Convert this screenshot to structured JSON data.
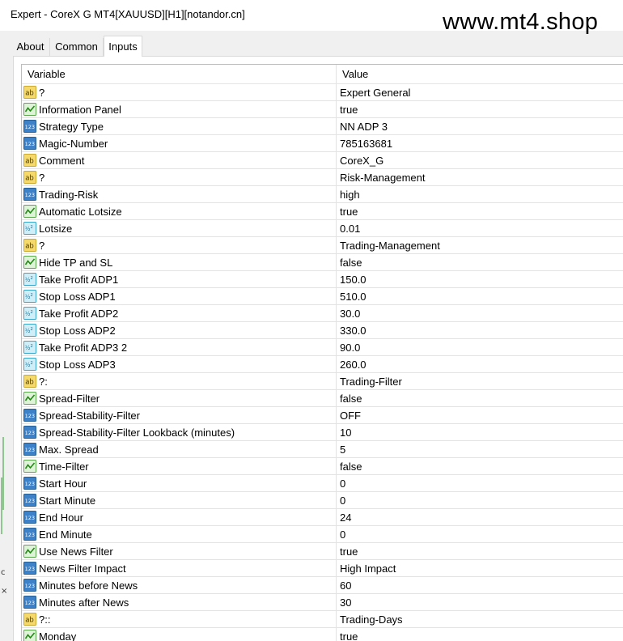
{
  "window": {
    "title": "Expert - CoreX G MT4[XAUUSD][H1][notandor.cn]"
  },
  "watermark": "www.mt4.shop",
  "tabs": [
    {
      "label": "About",
      "active": false
    },
    {
      "label": "Common",
      "active": false
    },
    {
      "label": "Inputs",
      "active": true
    }
  ],
  "table": {
    "columns": {
      "variable": "Variable",
      "value": "Value"
    },
    "rows": [
      {
        "icon": "ab",
        "variable": "?",
        "value": "Expert General"
      },
      {
        "icon": "bool",
        "variable": "Information Panel",
        "value": "true"
      },
      {
        "icon": "int",
        "variable": "Strategy Type",
        "value": "NN ADP 3"
      },
      {
        "icon": "int",
        "variable": "Magic-Number",
        "value": "785163681"
      },
      {
        "icon": "ab",
        "variable": "Comment",
        "value": "CoreX_G"
      },
      {
        "icon": "ab",
        "variable": "?",
        "value": "Risk-Management"
      },
      {
        "icon": "int",
        "variable": "Trading-Risk",
        "value": "high"
      },
      {
        "icon": "bool",
        "variable": "Automatic Lotsize",
        "value": "true"
      },
      {
        "icon": "dbl",
        "variable": "Lotsize",
        "value": "0.01"
      },
      {
        "icon": "ab",
        "variable": "?",
        "value": "Trading-Management"
      },
      {
        "icon": "bool",
        "variable": "Hide TP and SL",
        "value": "false"
      },
      {
        "icon": "dbl",
        "variable": "Take Profit ADP1",
        "value": "150.0"
      },
      {
        "icon": "dbl",
        "variable": "Stop Loss ADP1",
        "value": "510.0"
      },
      {
        "icon": "dbl",
        "variable": "Take Profit ADP2",
        "value": "30.0"
      },
      {
        "icon": "dbl",
        "variable": "Stop Loss ADP2",
        "value": "330.0"
      },
      {
        "icon": "dbl",
        "variable": "Take Profit ADP3 2",
        "value": "90.0"
      },
      {
        "icon": "dbl",
        "variable": "Stop Loss ADP3",
        "value": "260.0"
      },
      {
        "icon": "ab",
        "variable": "?:",
        "value": "Trading-Filter"
      },
      {
        "icon": "bool",
        "variable": "Spread-Filter",
        "value": "false"
      },
      {
        "icon": "int",
        "variable": "Spread-Stability-Filter",
        "value": "OFF"
      },
      {
        "icon": "int",
        "variable": "Spread-Stability-Filter Lookback (minutes)",
        "value": "10"
      },
      {
        "icon": "int",
        "variable": "Max. Spread",
        "value": "5"
      },
      {
        "icon": "bool",
        "variable": "Time-Filter",
        "value": "false"
      },
      {
        "icon": "int",
        "variable": "Start Hour",
        "value": "0"
      },
      {
        "icon": "int",
        "variable": "Start Minute",
        "value": "0"
      },
      {
        "icon": "int",
        "variable": "End Hour",
        "value": "24"
      },
      {
        "icon": "int",
        "variable": "End Minute",
        "value": "0"
      },
      {
        "icon": "bool",
        "variable": "Use News Filter",
        "value": "true"
      },
      {
        "icon": "int",
        "variable": "News Filter Impact",
        "value": "High Impact"
      },
      {
        "icon": "int",
        "variable": "Minutes before News",
        "value": "60"
      },
      {
        "icon": "int",
        "variable": "Minutes after News",
        "value": "30"
      },
      {
        "icon": "ab",
        "variable": "?::",
        "value": "Trading-Days"
      },
      {
        "icon": "bool",
        "variable": "Monday",
        "value": "true"
      }
    ]
  }
}
